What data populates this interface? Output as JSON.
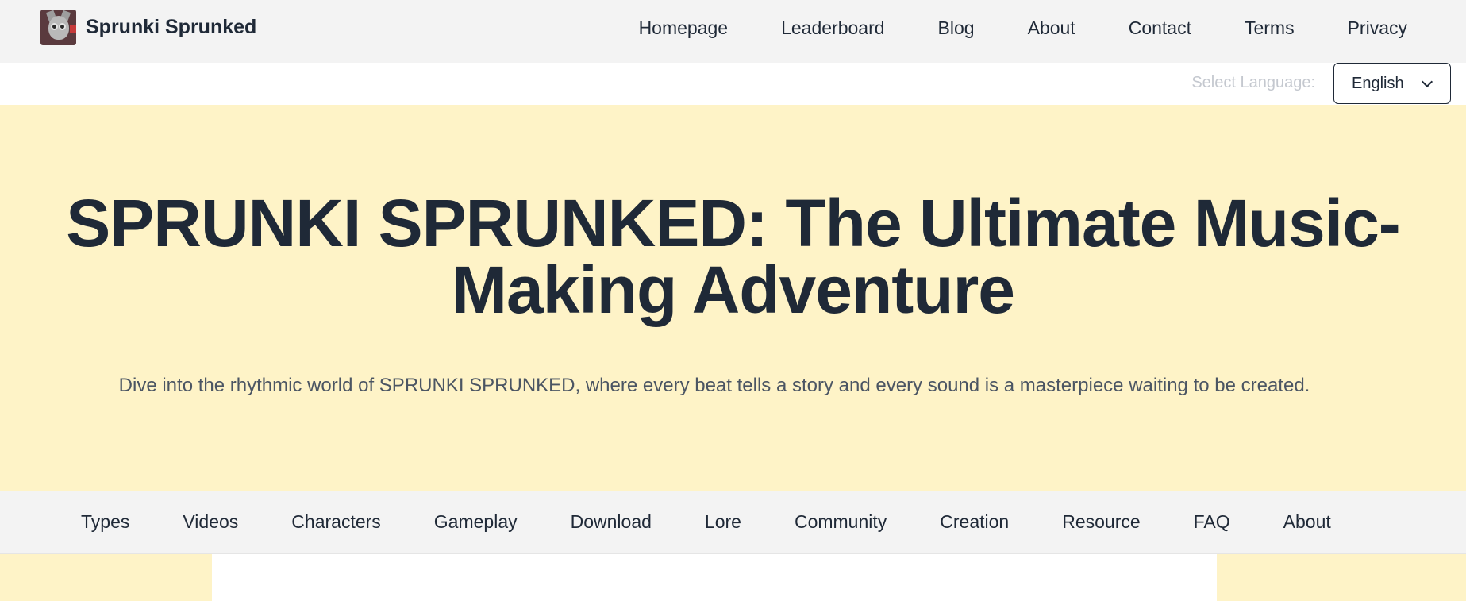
{
  "brand": {
    "name": "Sprunki Sprunked",
    "logo_icon": "sprunki-character-logo"
  },
  "main_nav": [
    "Homepage",
    "Leaderboard",
    "Blog",
    "About",
    "Contact",
    "Terms",
    "Privacy"
  ],
  "language": {
    "label": "Select Language:",
    "selected": "English",
    "icon": "chevron-down-icon"
  },
  "hero": {
    "title": "SPRUNKI SPRUNKED: The Ultimate Music-Making Adventure",
    "subtitle": "Dive into the rhythmic world of SPRUNKI SPRUNKED, where every beat tells a story and every sound is a masterpiece waiting to be created."
  },
  "sub_nav": [
    "Types",
    "Videos",
    "Characters",
    "Gameplay",
    "Download",
    "Lore",
    "Community",
    "Creation",
    "Resource",
    "FAQ",
    "About"
  ],
  "colors": {
    "hero_bg": "#fef3c7",
    "nav_bg": "#f3f3f3",
    "text": "#1f2937",
    "muted": "#c4c8cf"
  }
}
